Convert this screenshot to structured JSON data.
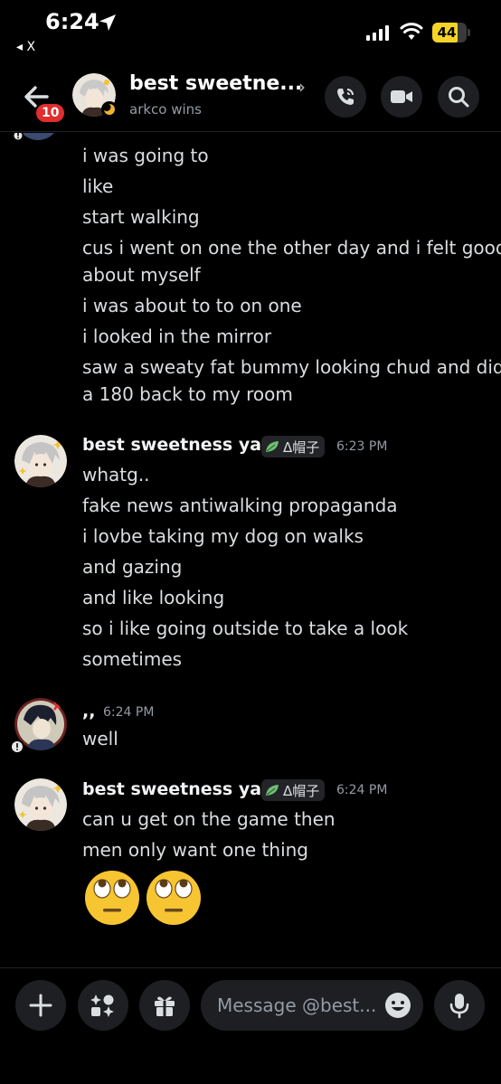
{
  "status_bar": {
    "time": "6:24",
    "back_app": "◂ X",
    "battery": "44"
  },
  "header": {
    "title": "best sweetne...",
    "subtitle": "arkco wins",
    "unread_count": "10",
    "chevron": "›"
  },
  "messages": {
    "partial_lines": [
      "i was going to",
      "like",
      "start walking",
      "cus i went on one the other day and i felt good",
      "about myself",
      "i was about to to on one",
      "i looked in the mirror",
      "saw a sweaty fat bummy looking chud and did",
      "a 180 back to my room"
    ],
    "group1": {
      "author": "best sweetness yan",
      "tag": "Δ帽子",
      "time": "6:23 PM",
      "lines": [
        "whatg..",
        "fake news antiwalking propaganda",
        "i lovbe taking my dog on walks",
        "and gazing",
        "and like looking",
        "so i like going outside to take a look",
        "sometimes"
      ]
    },
    "group2": {
      "author": ",,",
      "time": "6:24 PM",
      "lines": [
        "well"
      ]
    },
    "group3": {
      "author": "best sweetness yan",
      "tag": "Δ帽子",
      "time": "6:24 PM",
      "lines": [
        "can u get on the game then",
        "men only want one thing"
      ],
      "emojis": [
        "face-with-rolling-eyes",
        "face-with-rolling-eyes"
      ]
    }
  },
  "composer": {
    "placeholder": "Message @best..."
  },
  "colors": {
    "background": "#000000",
    "text": "#dbdee1",
    "muted": "#949ba4",
    "button_bg": "#1e1f22",
    "badge": "#e02d2d",
    "battery": "#f5d328"
  }
}
